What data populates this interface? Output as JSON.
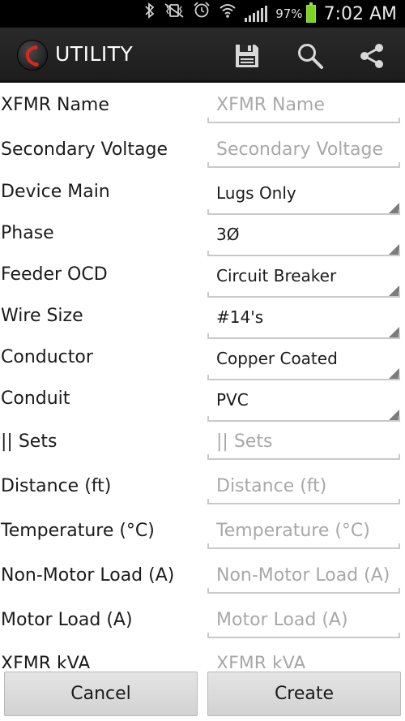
{
  "status_bar": {
    "battery_percent": "97%",
    "time": "7:02 AM",
    "icons": [
      "bluetooth-icon",
      "vibrate-mute-icon",
      "alarm-icon",
      "wifi-icon",
      "signal-icon",
      "battery-icon"
    ],
    "battery_color": "#7ed321"
  },
  "action_bar": {
    "title": "UTILITY",
    "actions": [
      "save-icon",
      "search-icon",
      "share-icon"
    ],
    "logo_accent": "#e0261b"
  },
  "form": {
    "fields": [
      {
        "label": "XFMR Name",
        "type": "text",
        "value": "",
        "placeholder": "XFMR Name"
      },
      {
        "label": "Secondary Voltage",
        "type": "text",
        "value": "",
        "placeholder": "Secondary Voltage"
      },
      {
        "label": "Device Main",
        "type": "spinner",
        "value": "Lugs Only",
        "placeholder": ""
      },
      {
        "label": "Phase",
        "type": "spinner",
        "value": "3Ø",
        "placeholder": ""
      },
      {
        "label": "Feeder OCD",
        "type": "spinner",
        "value": "Circuit Breaker",
        "placeholder": ""
      },
      {
        "label": "Wire Size",
        "type": "spinner",
        "value": "#14's",
        "placeholder": ""
      },
      {
        "label": "Conductor",
        "type": "spinner",
        "value": "Copper Coated",
        "placeholder": ""
      },
      {
        "label": "Conduit",
        "type": "spinner",
        "value": "PVC",
        "placeholder": ""
      },
      {
        "label": "|| Sets",
        "type": "text",
        "value": "",
        "placeholder": "|| Sets"
      },
      {
        "label": "Distance (ft)",
        "type": "text",
        "value": "",
        "placeholder": "Distance (ft)"
      },
      {
        "label": "Temperature (°C)",
        "type": "text",
        "value": "",
        "placeholder": "Temperature (°C)"
      },
      {
        "label": "Non-Motor Load (A)",
        "type": "text",
        "value": "",
        "placeholder": "Non-Motor Load (A)"
      },
      {
        "label": "Motor Load (A)",
        "type": "text",
        "value": "",
        "placeholder": "Motor Load (A)"
      },
      {
        "label": "XFMR kVA",
        "type": "text",
        "value": "",
        "placeholder": "XFMR kVA"
      }
    ]
  },
  "buttons": {
    "cancel_label": "Cancel",
    "create_label": "Create"
  }
}
